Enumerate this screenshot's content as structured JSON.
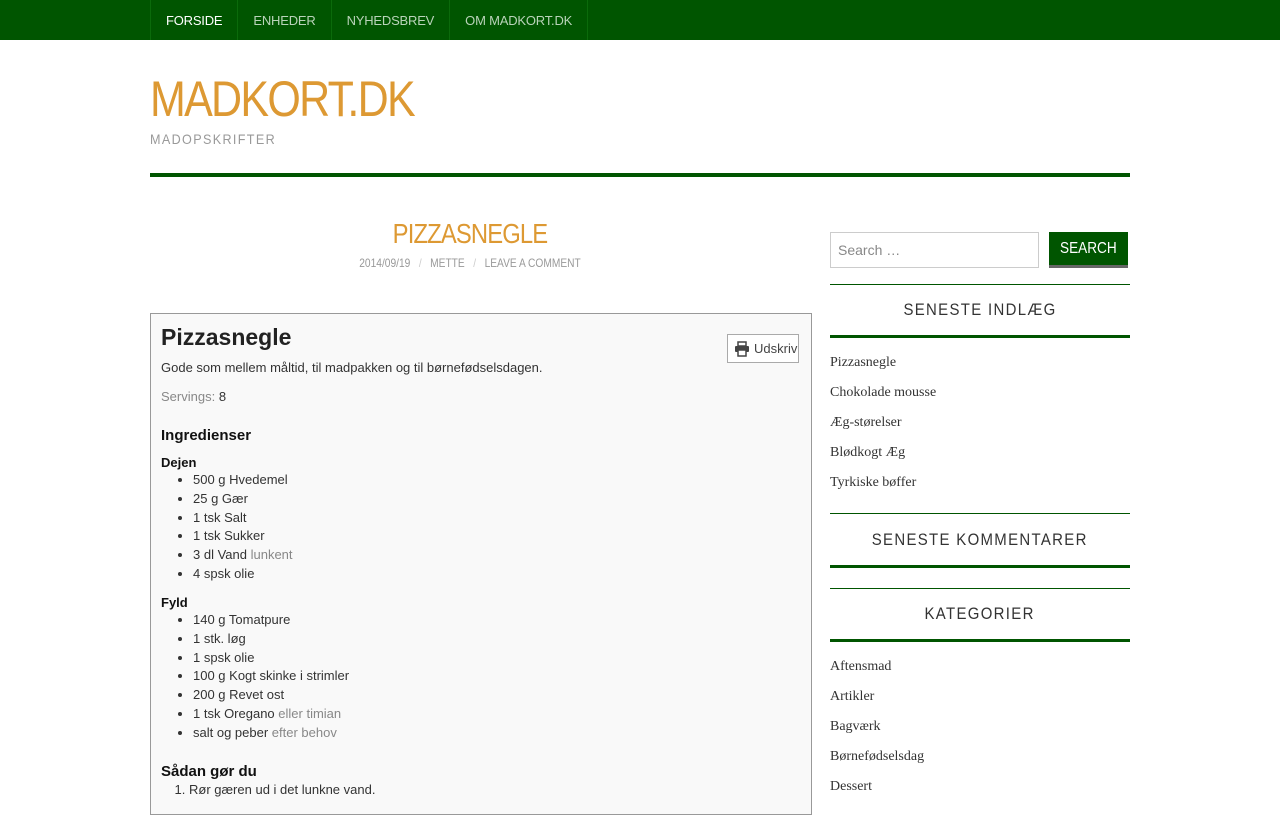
{
  "nav": {
    "items": [
      {
        "label": "FORSIDE"
      },
      {
        "label": "ENHEDER"
      },
      {
        "label": "NYHEDSBREV"
      },
      {
        "label": "OM MADKORT.DK"
      }
    ]
  },
  "site": {
    "title": "MADKORT.DK",
    "tagline": "MADOPSKRIFTER"
  },
  "post": {
    "title": "PIZZASNEGLE",
    "date": "2014/09/19",
    "author": "METTE",
    "comment_link": "LEAVE A COMMENT"
  },
  "recipe": {
    "name": "Pizzasnegle",
    "print_label": "Udskriv",
    "summary": "Gode som mellem måltid, til madpakken og til børnefødselsdagen.",
    "servings_label": "Servings:",
    "servings_value": "8",
    "ingredients_heading": "Ingredienser",
    "groups": [
      {
        "name": "Dejen",
        "items": [
          {
            "text": "500 g Hvedemel",
            "note": ""
          },
          {
            "text": "25 g Gær",
            "note": ""
          },
          {
            "text": "1 tsk Salt",
            "note": ""
          },
          {
            "text": "1 tsk Sukker",
            "note": ""
          },
          {
            "text": "3 dl Vand",
            "note": "lunkent"
          },
          {
            "text": "4 spsk olie",
            "note": ""
          }
        ]
      },
      {
        "name": "Fyld",
        "items": [
          {
            "text": "140 g Tomatpure",
            "note": ""
          },
          {
            "text": "1 stk. løg",
            "note": ""
          },
          {
            "text": "1 spsk olie",
            "note": ""
          },
          {
            "text": "100 g Kogt skinke i strimler",
            "note": ""
          },
          {
            "text": "200 g Revet ost",
            "note": ""
          },
          {
            "text": "1 tsk Oregano",
            "note": "eller timian"
          },
          {
            "text": "salt og peber",
            "note": "efter behov"
          }
        ]
      }
    ],
    "instructions_heading": "Sådan gør du",
    "steps": [
      "Rør gæren ud i det lunkne vand."
    ]
  },
  "sidebar": {
    "search_placeholder": "Search …",
    "search_button": "SEARCH",
    "recent_posts_title": "SENESTE INDLÆG",
    "recent_posts": [
      "Pizzasnegle",
      "Chokolade mousse",
      "Æg-størelser",
      "Blødkogt Æg",
      "Tyrkiske bøffer"
    ],
    "recent_comments_title": "SENESTE KOMMENTARER",
    "categories_title": "KATEGORIER",
    "categories": [
      "Aftensmad",
      "Artikler",
      "Bagværk",
      "Børnefødselsdag",
      "Dessert"
    ]
  },
  "colors": {
    "brand_green": "#005500",
    "accent_orange": "#dd9933"
  }
}
